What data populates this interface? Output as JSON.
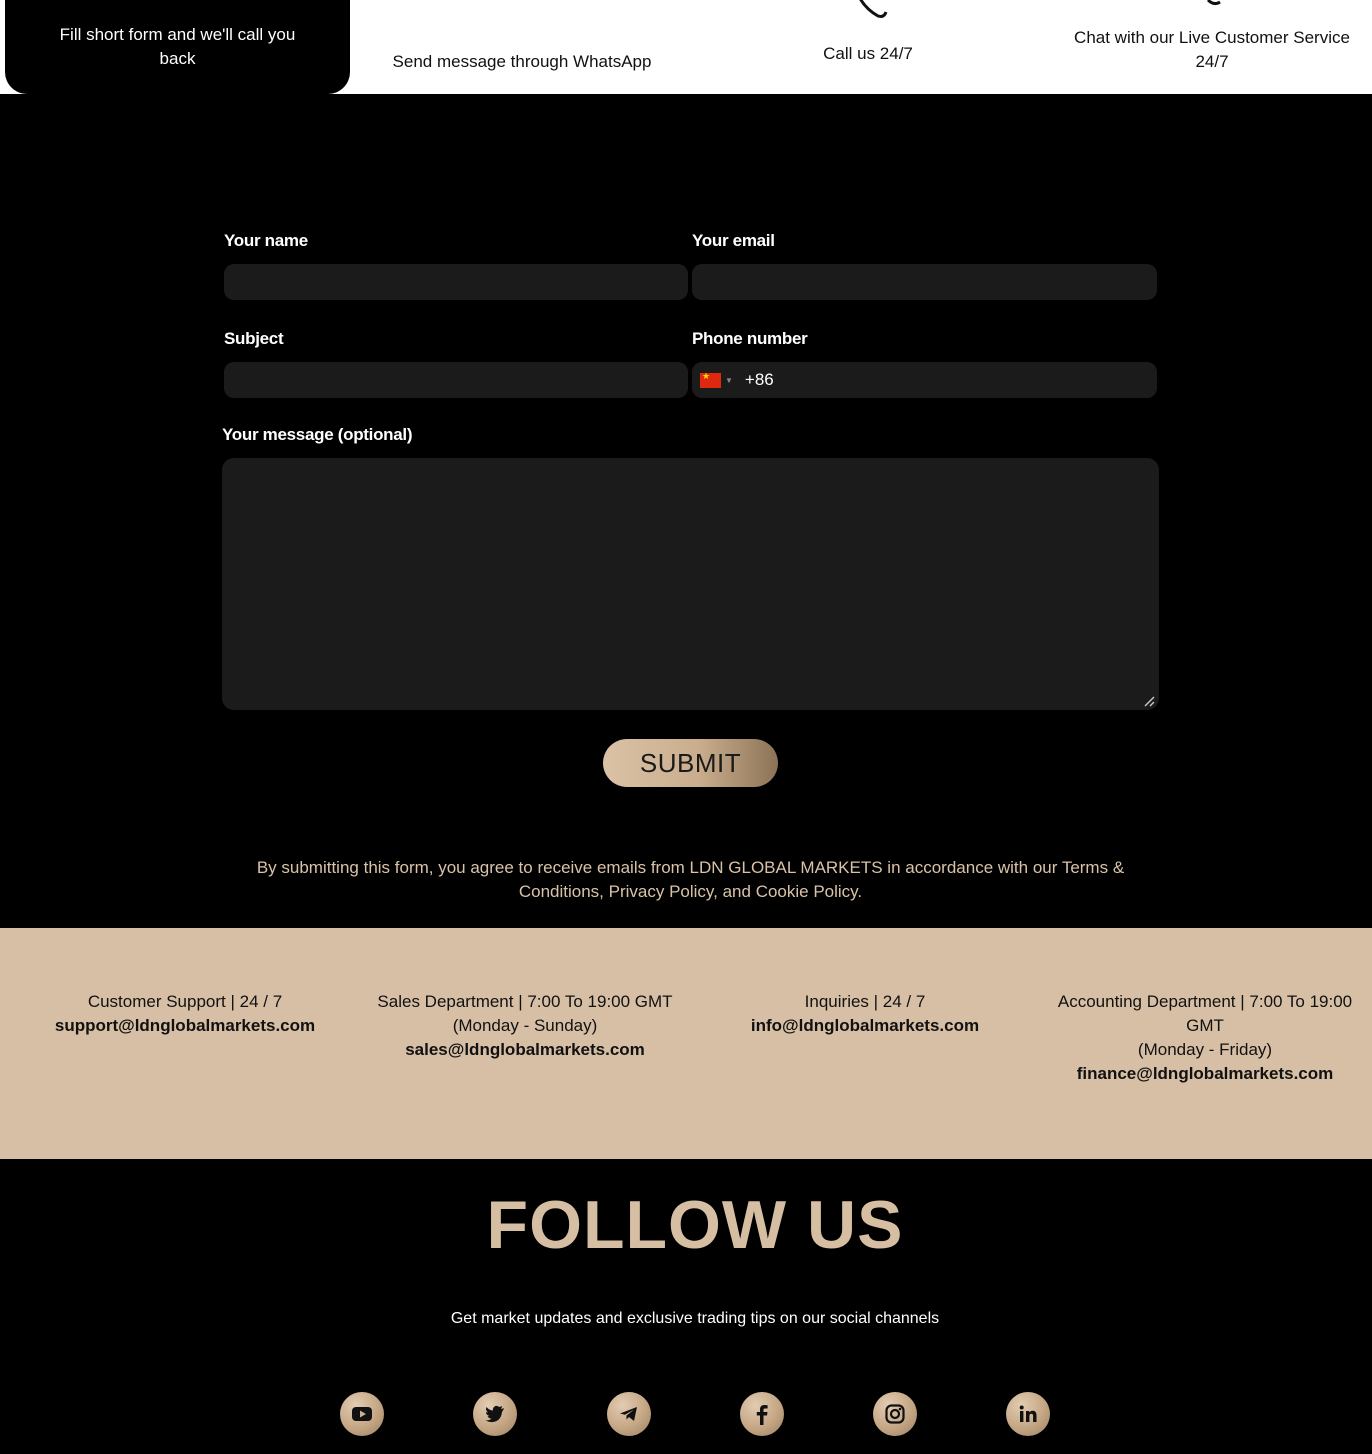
{
  "top": {
    "form_card": "Fill short form and we'll call you back",
    "whatsapp": "Send message through WhatsApp",
    "call": "Call us 24/7",
    "chat": "Chat with our Live Customer Service 24/7"
  },
  "form": {
    "name_label": "Your name",
    "email_label": "Your email",
    "subject_label": "Subject",
    "phone_label": "Phone number",
    "phone_value": "+86",
    "message_label": "Your message (optional)",
    "submit_label": "SUBMIT",
    "consent": "By submitting this form, you agree to receive emails from LDN GLOBAL MARKETS in accordance with our Terms & Conditions, Privacy Policy, and Cookie Policy."
  },
  "departments": [
    {
      "title": "Customer Support | 24 / 7",
      "hours": "",
      "email": "support@ldnglobalmarkets.com"
    },
    {
      "title": "Sales Department | 7:00 To 19:00 GMT",
      "hours": "(Monday - Sunday)",
      "email": "sales@ldnglobalmarkets.com"
    },
    {
      "title": "Inquiries | 24 / 7",
      "hours": "",
      "email": "info@ldnglobalmarkets.com"
    },
    {
      "title": "Accounting Department | 7:00 To 19:00 GMT",
      "hours": "(Monday - Friday)",
      "email": "finance@ldnglobalmarkets.com"
    }
  ],
  "follow": {
    "title": "FOLLOW US",
    "subtitle": "Get market updates and exclusive trading tips on our social channels"
  },
  "socials": [
    "youtube-icon",
    "twitter-icon",
    "telegram-icon",
    "facebook-icon",
    "instagram-icon",
    "linkedin-icon"
  ],
  "colors": {
    "accent": "#d7bfa5",
    "field_bg": "#1b1b1b",
    "consent_text": "#d9c3a8"
  }
}
